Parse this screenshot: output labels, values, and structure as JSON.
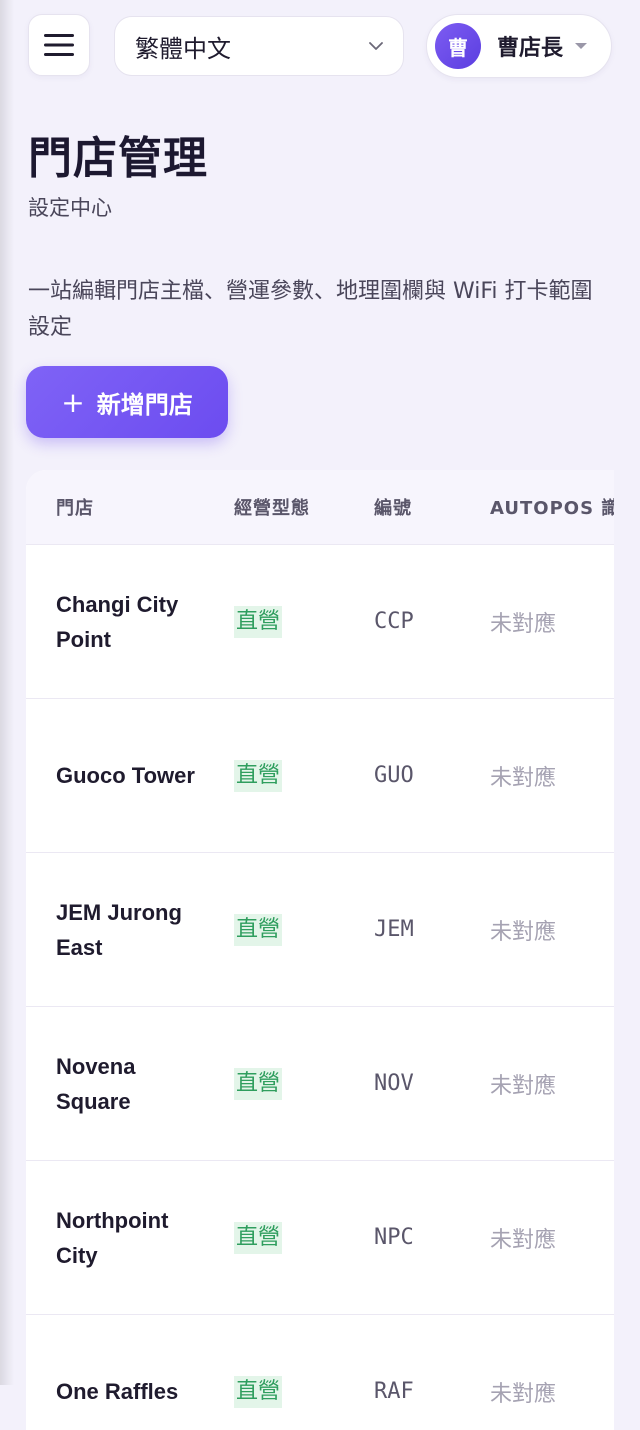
{
  "header": {
    "language": "繁體中文",
    "user_initial": "曹",
    "user_name": "曹店長"
  },
  "page": {
    "title": "門店管理",
    "subtitle": "設定中心",
    "description": "一站編輯門店主檔、營運參數、地理圍欄與 WiFi 打卡範圍設定",
    "add_button_label": "新增門店"
  },
  "table": {
    "columns": [
      "門店",
      "經營型態",
      "編號",
      "AUTOPOS 識"
    ],
    "rows": [
      {
        "name": "Changi City Point",
        "type": "直營",
        "code": "CCP",
        "autopos": "未對應"
      },
      {
        "name": "Guoco Tower",
        "type": "直營",
        "code": "GUO",
        "autopos": "未對應"
      },
      {
        "name": "JEM Jurong East",
        "type": "直營",
        "code": "JEM",
        "autopos": "未對應"
      },
      {
        "name": "Novena Square",
        "type": "直營",
        "code": "NOV",
        "autopos": "未對應"
      },
      {
        "name": "Northpoint City",
        "type": "直營",
        "code": "NPC",
        "autopos": "未對應"
      },
      {
        "name": "One Raffles",
        "type": "直營",
        "code": "RAF",
        "autopos": "未對應"
      }
    ]
  },
  "colors": {
    "accent": "#6c4cf0",
    "badge_bg": "#e3f5e9",
    "badge_text": "#2f9e5e",
    "page_bg": "#f3f1fb"
  },
  "icons": {
    "menu": "hamburger-icon",
    "lang_dropdown": "chevron-down-icon",
    "user_dropdown": "caret-down-icon",
    "add": "plus-icon"
  }
}
